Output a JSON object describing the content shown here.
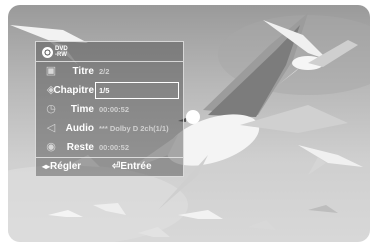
{
  "disc_logo": {
    "line1": "DVD",
    "line2": "-RW"
  },
  "rows": [
    {
      "icon": "title-icon",
      "label": "Titre",
      "value": "2/2"
    },
    {
      "icon": "chapter-icon",
      "label": "Chapitre",
      "value": "1/5"
    },
    {
      "icon": "clock-icon",
      "label": "Time",
      "value": "00:00:52"
    },
    {
      "icon": "speaker-icon",
      "label": "Audio",
      "value": "*** Dolby D 2ch(1/1)"
    },
    {
      "icon": "remaining-icon",
      "label": "Reste",
      "value": "00:00:52"
    }
  ],
  "footer": {
    "adjust_arrows": "◂▸",
    "adjust_label": "Régler",
    "enter_icon": "⏎",
    "enter_label": "Entrée"
  },
  "colors": {
    "osd_border": "#e6e6e6",
    "text": "#ffffff",
    "value_text": "#d0d0d0"
  }
}
